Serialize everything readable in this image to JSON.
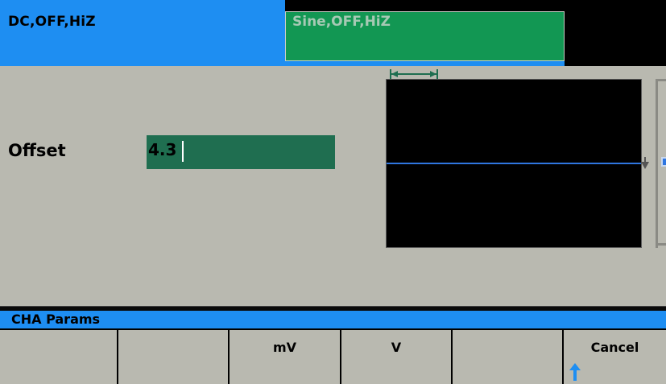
{
  "channels": {
    "cha_tab_label": "DC,OFF,HiZ",
    "chb_tab_label": "Sine,OFF,HiZ"
  },
  "parameter": {
    "name": "Offset",
    "entry_value": "4.3"
  },
  "menu_title": "CHA Params",
  "softkeys": [
    {
      "label": ""
    },
    {
      "label": ""
    },
    {
      "label": "mV"
    },
    {
      "label": "V"
    },
    {
      "label": ""
    },
    {
      "label": "Cancel",
      "icon": "up-arrow-icon"
    }
  ],
  "colors": {
    "cha_tab": "#1e8ef2",
    "chb_tab": "#129753",
    "panel_bg": "#b9b9b0",
    "entry_field": "#1f6e50",
    "waveform_line": "#2f76e0"
  }
}
